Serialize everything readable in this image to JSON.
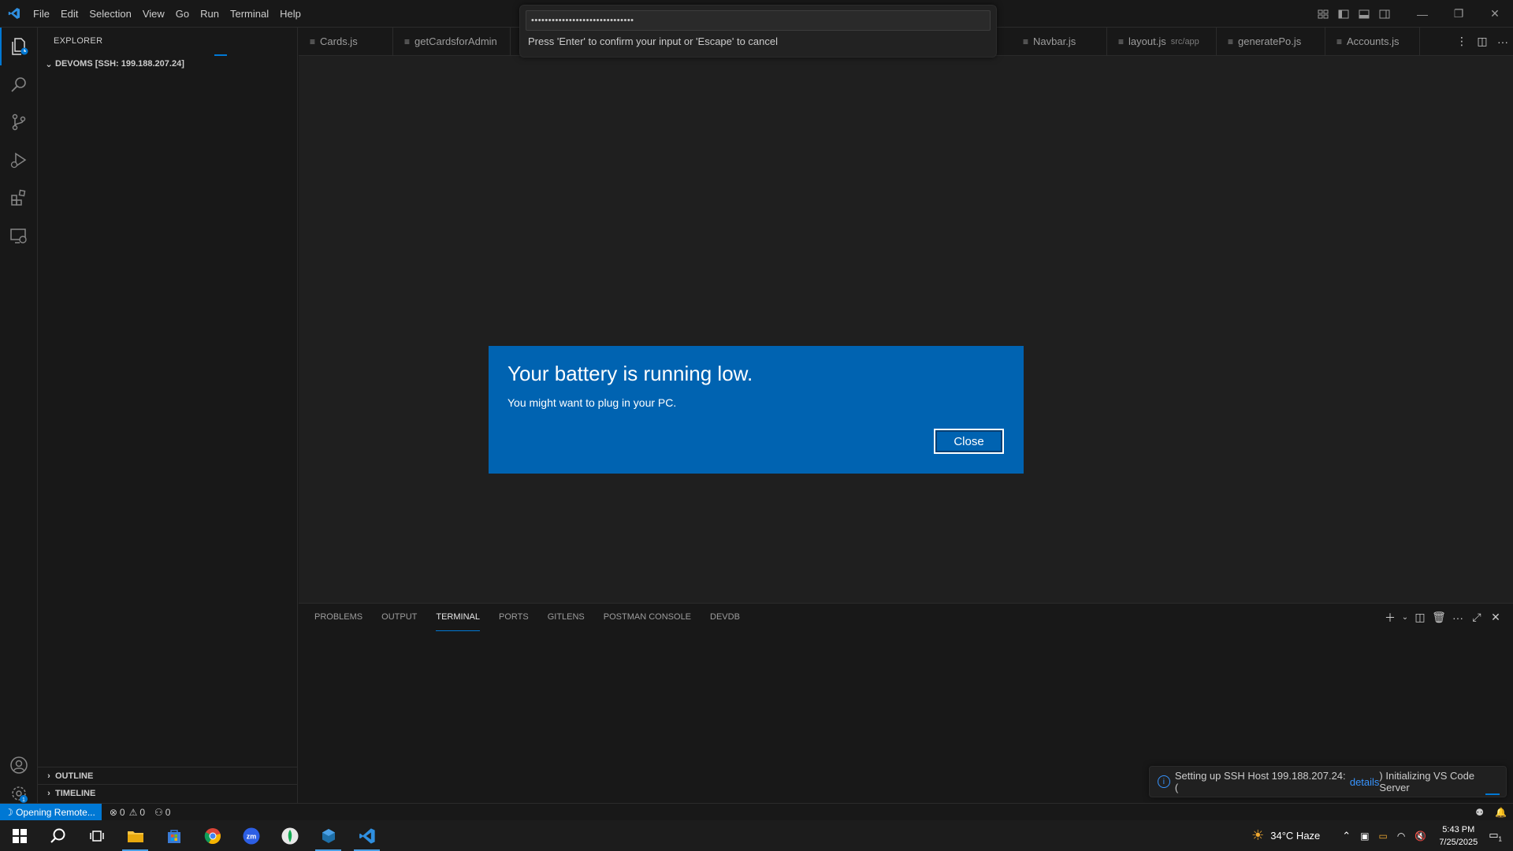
{
  "titlebar": {
    "menu": [
      "File",
      "Edit",
      "Selection",
      "View",
      "Go",
      "Run",
      "Terminal",
      "Help"
    ]
  },
  "quick_input": {
    "value": "••••••••••••••••••••••••••••••",
    "message": "Press 'Enter' to confirm your input or 'Escape' to cancel"
  },
  "sidebar": {
    "title": "EXPLORER",
    "workspace": "DEVOMS [SSH: 199.188.207.24]",
    "outline": "OUTLINE",
    "timeline": "TIMELINE"
  },
  "tabs": [
    {
      "label": "Cards.js",
      "desc": ""
    },
    {
      "label": "getCardsforAdmin",
      "desc": ""
    },
    {
      "label": "Navbar.js",
      "desc": ""
    },
    {
      "label": "layout.js",
      "desc": "src/app"
    },
    {
      "label": "generatePo.js",
      "desc": ""
    },
    {
      "label": "Accounts.js",
      "desc": ""
    }
  ],
  "panel": {
    "tabs": [
      "PROBLEMS",
      "OUTPUT",
      "TERMINAL",
      "PORTS",
      "GITLENS",
      "POSTMAN CONSOLE",
      "DEVDB"
    ],
    "active_tab": "TERMINAL"
  },
  "notification": {
    "prefix": "Setting up SSH Host 199.188.207.24: (",
    "link": "details",
    "suffix": ") Initializing VS Code Server"
  },
  "statusbar": {
    "remote": "Opening Remote...",
    "errors": "0",
    "warnings": "0",
    "ports": "0"
  },
  "toast": {
    "title": "Your battery is running low.",
    "body": "You might want to plug in your PC.",
    "close_label": "Close"
  },
  "taskbar": {
    "weather": "34°C  Haze",
    "time": "5:43 PM",
    "date": "7/25/2025",
    "notification_count": "1"
  },
  "colors": {
    "accent": "#0078d4",
    "toast_bg": "#0063b1",
    "editor_bg": "#1f1f1f"
  },
  "icons": {
    "activity_bar": [
      "explorer-icon",
      "search-icon",
      "source-control-icon",
      "run-debug-icon",
      "extensions-icon",
      "remote-explorer-icon",
      "account-icon",
      "settings-gear-icon"
    ]
  }
}
